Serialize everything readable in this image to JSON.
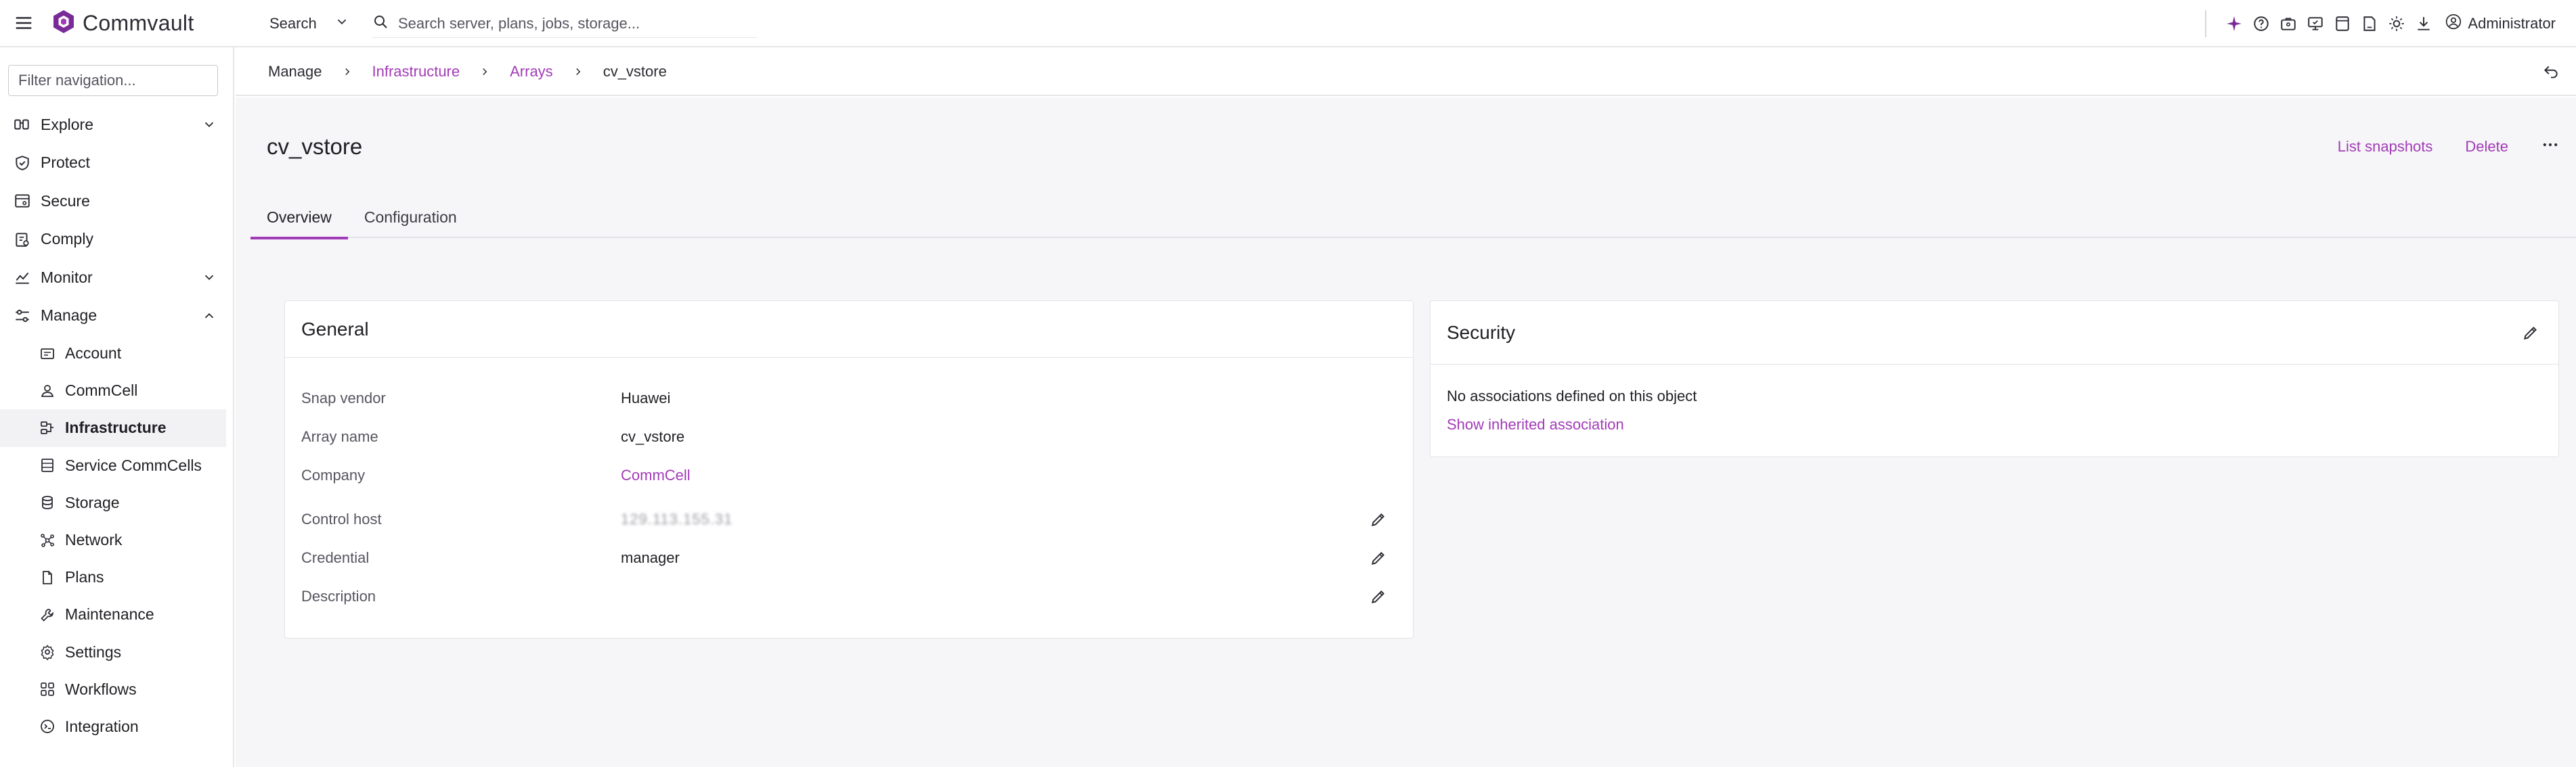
{
  "brand": {
    "name": "Commvault",
    "accent": "#a23bb7"
  },
  "topbar": {
    "search_scope": "Search",
    "search_placeholder": "Search server, plans, jobs, storage...",
    "icons": [
      "sparkle-icon",
      "help-icon",
      "briefcase-icon",
      "monitor-icon",
      "tablet-icon",
      "device-icon",
      "theme-icon",
      "download-icon"
    ],
    "user": "Administrator"
  },
  "sidebar": {
    "filter_placeholder": "Filter navigation...",
    "items": [
      {
        "label": "Explore",
        "icon": "explore-icon",
        "expandable": true
      },
      {
        "label": "Protect",
        "icon": "shield-check-icon"
      },
      {
        "label": "Secure",
        "icon": "secure-icon"
      },
      {
        "label": "Comply",
        "icon": "comply-icon"
      },
      {
        "label": "Monitor",
        "icon": "chart-icon",
        "expandable": true
      },
      {
        "label": "Manage",
        "icon": "sliders-icon",
        "expanded": true
      }
    ],
    "sub_items": [
      {
        "label": "Account",
        "icon": "account-icon"
      },
      {
        "label": "CommCell",
        "icon": "user-icon"
      },
      {
        "label": "Infrastructure",
        "icon": "infrastructure-icon",
        "active": true
      },
      {
        "label": "Service CommCells",
        "icon": "server-icon"
      },
      {
        "label": "Storage",
        "icon": "database-icon"
      },
      {
        "label": "Network",
        "icon": "network-icon"
      },
      {
        "label": "Plans",
        "icon": "document-icon"
      },
      {
        "label": "Maintenance",
        "icon": "wrench-icon"
      },
      {
        "label": "Settings",
        "icon": "gear-icon"
      },
      {
        "label": "Workflows",
        "icon": "workflow-icon"
      },
      {
        "label": "Integration",
        "icon": "integration-icon"
      }
    ]
  },
  "breadcrumb": {
    "items": [
      {
        "label": "Manage",
        "link": false
      },
      {
        "label": "Infrastructure",
        "link": true
      },
      {
        "label": "Arrays",
        "link": true
      },
      {
        "label": "cv_vstore",
        "link": false
      }
    ]
  },
  "page": {
    "title": "cv_vstore",
    "actions": {
      "list_snapshots": "List snapshots",
      "delete": "Delete"
    },
    "tabs": [
      {
        "label": "Overview",
        "active": true
      },
      {
        "label": "Configuration",
        "active": false
      }
    ]
  },
  "general": {
    "title": "General",
    "rows": [
      {
        "label": "Snap vendor",
        "value": "Huawei"
      },
      {
        "label": "Array name",
        "value": "cv_vstore"
      },
      {
        "label": "Company",
        "value": "CommCell",
        "link": true
      },
      {
        "label": "Control host",
        "value": "129.113.155.31",
        "editable": true,
        "blurred": true
      },
      {
        "label": "Credential",
        "value": "manager",
        "editable": true
      },
      {
        "label": "Description",
        "value": "",
        "editable": true
      }
    ]
  },
  "security": {
    "title": "Security",
    "no_assoc": "No associations defined on this object",
    "inherited_link": "Show inherited association"
  }
}
